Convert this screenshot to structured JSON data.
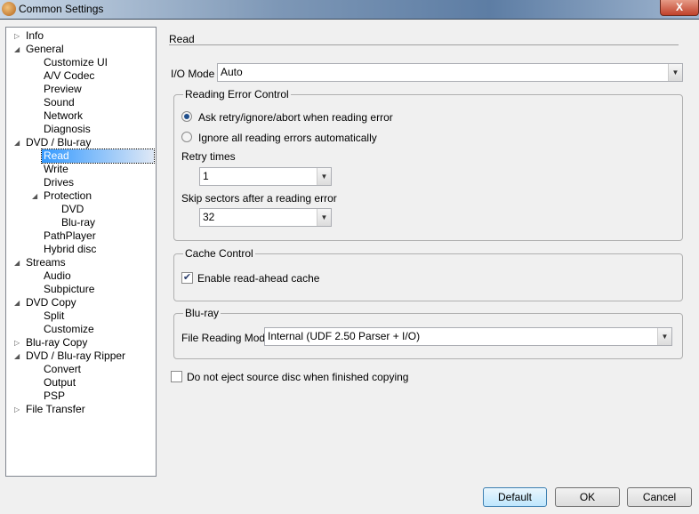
{
  "window": {
    "title": "Common Settings",
    "close_label": "X"
  },
  "tree": [
    {
      "label": "Info",
      "level": 0,
      "arrow": "collapsed"
    },
    {
      "label": "General",
      "level": 0,
      "arrow": "expanded"
    },
    {
      "label": "Customize UI",
      "level": 1
    },
    {
      "label": "A/V Codec",
      "level": 1
    },
    {
      "label": "Preview",
      "level": 1
    },
    {
      "label": "Sound",
      "level": 1
    },
    {
      "label": "Network",
      "level": 1
    },
    {
      "label": "Diagnosis",
      "level": 1
    },
    {
      "label": "DVD / Blu-ray",
      "level": 0,
      "arrow": "expanded"
    },
    {
      "label": "Read",
      "level": 1,
      "selected": true
    },
    {
      "label": "Write",
      "level": 1
    },
    {
      "label": "Drives",
      "level": 1
    },
    {
      "label": "Protection",
      "level": 1,
      "arrow": "expanded"
    },
    {
      "label": "DVD",
      "level": 2
    },
    {
      "label": "Blu-ray",
      "level": 2
    },
    {
      "label": "PathPlayer",
      "level": 1
    },
    {
      "label": "Hybrid disc",
      "level": 1
    },
    {
      "label": "Streams",
      "level": 0,
      "arrow": "expanded"
    },
    {
      "label": "Audio",
      "level": 1
    },
    {
      "label": "Subpicture",
      "level": 1
    },
    {
      "label": "DVD Copy",
      "level": 0,
      "arrow": "expanded"
    },
    {
      "label": "Split",
      "level": 1
    },
    {
      "label": "Customize",
      "level": 1
    },
    {
      "label": "Blu-ray Copy",
      "level": 0,
      "arrow": "collapsed"
    },
    {
      "label": "DVD / Blu-ray Ripper",
      "level": 0,
      "arrow": "expanded"
    },
    {
      "label": "Convert",
      "level": 1
    },
    {
      "label": "Output",
      "level": 1
    },
    {
      "label": "PSP",
      "level": 1
    },
    {
      "label": "File Transfer",
      "level": 0,
      "arrow": "collapsed"
    }
  ],
  "main": {
    "section_title": "Read",
    "io_mode_label": "I/O Mode",
    "io_mode_value": "Auto",
    "reading_error": {
      "title": "Reading Error Control",
      "radio1": "Ask retry/ignore/abort when reading error",
      "radio2": "Ignore all reading errors automatically",
      "retry_label": "Retry times",
      "retry_value": "1",
      "skip_label": "Skip sectors after a reading error",
      "skip_value": "32"
    },
    "cache": {
      "title": "Cache Control",
      "checkbox": "Enable read-ahead cache",
      "checked": true
    },
    "bluray": {
      "title": "Blu-ray",
      "mode_label": "File Reading Mode",
      "mode_value": "Internal (UDF 2.50 Parser + I/O)"
    },
    "no_eject": {
      "label": "Do not eject source disc when finished copying",
      "checked": false
    }
  },
  "buttons": {
    "default": "Default",
    "ok": "OK",
    "cancel": "Cancel"
  }
}
